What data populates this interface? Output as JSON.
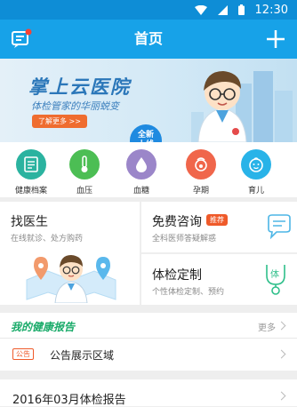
{
  "status_bar": {
    "time": "12:30"
  },
  "nav": {
    "title": "首页"
  },
  "banner": {
    "title": "掌上云医院",
    "subtitle": "体检管家的华丽蜕变",
    "button": "了解更多 >>",
    "badge": "全新上线"
  },
  "categories": [
    {
      "label": "健康档案",
      "icon": "file-icon",
      "color": "#2bb3a0"
    },
    {
      "label": "血压",
      "icon": "thermometer-icon",
      "color": "#4cbe54"
    },
    {
      "label": "血糖",
      "icon": "drop-icon",
      "color": "#9b86c9"
    },
    {
      "label": "孕期",
      "icon": "pregnancy-icon",
      "color": "#f0664b"
    },
    {
      "label": "育儿",
      "icon": "baby-icon",
      "color": "#29b3e8"
    }
  ],
  "find_doctor": {
    "title": "找医生",
    "subtitle": "在线就诊、处方购药"
  },
  "consult": {
    "title": "免费咨询",
    "tag": "推荐",
    "subtitle": "全科医师答疑解惑"
  },
  "checkup": {
    "title": "体检定制",
    "subtitle": "个性体检定制、预约",
    "icon_text": "体"
  },
  "report": {
    "title": "我的健康报告",
    "more": "更多"
  },
  "notice": {
    "tag": "公告",
    "text": "公告展示区域"
  },
  "report_item": {
    "text": "2016年03月体检报告"
  }
}
